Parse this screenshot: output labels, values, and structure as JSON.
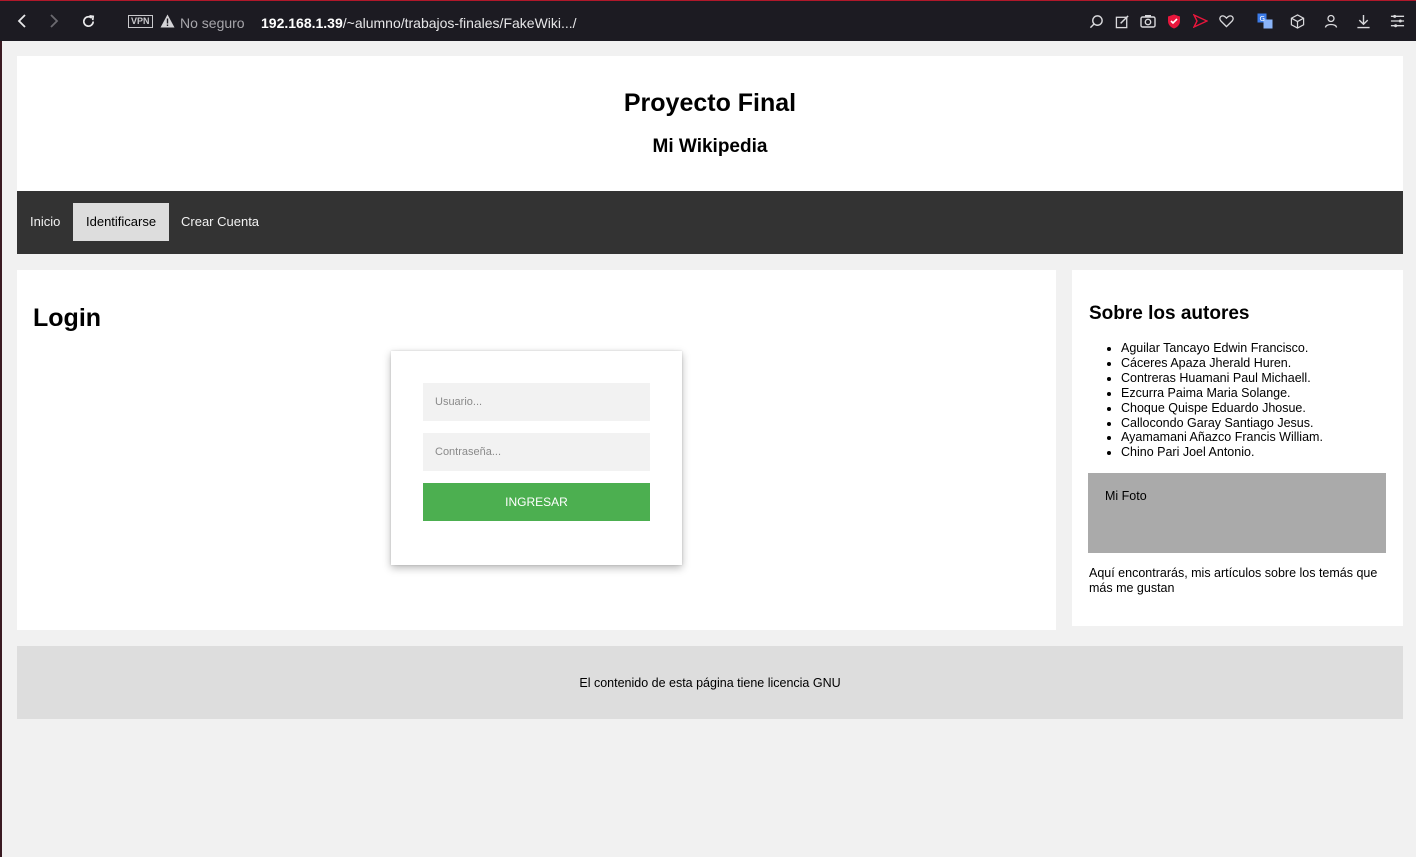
{
  "browser": {
    "vpn_label": "VPN",
    "security_text": "No seguro",
    "url_host": "192.168.1.39",
    "url_path": "/~alumno/trabajos-finales/FakeWiki.../",
    "accent_color": "#b0182a"
  },
  "header": {
    "title": "Proyecto Final",
    "subtitle": "Mi Wikipedia"
  },
  "nav": {
    "items": [
      {
        "label": "Inicio",
        "active": false
      },
      {
        "label": "Identificarse",
        "active": true
      },
      {
        "label": "Crear Cuenta",
        "active": false
      }
    ]
  },
  "login": {
    "title": "Login",
    "username_placeholder": "Usuario...",
    "password_placeholder": "Contraseña...",
    "submit_label": "INGRESAR",
    "submit_color": "#4caf50"
  },
  "sidebar": {
    "title": "Sobre los autores",
    "authors": [
      "Aguilar Tancayo Edwin Francisco.",
      "Cáceres Apaza Jherald Huren.",
      "Contreras Huamani Paul Michaell.",
      "Ezcurra Paima Maria Solange.",
      "Choque Quispe Eduardo Jhosue.",
      "Callocondo Garay Santiago Jesus.",
      "Ayamamani Añazco Francis William.",
      "Chino Pari Joel Antonio."
    ],
    "photo_label": "Mi Foto",
    "description": "Aquí encontrarás, mis artículos sobre los temás que más me gustan"
  },
  "footer": {
    "text": "El contenido de esta página tiene licencia GNU"
  }
}
